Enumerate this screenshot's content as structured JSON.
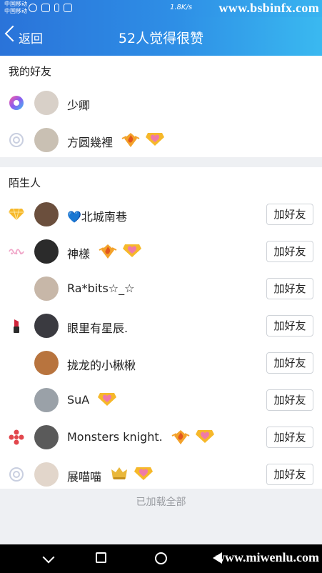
{
  "statusbar": {
    "carrier1": "中国移动",
    "carrier2": "中国移动",
    "speed": "1.8K/s",
    "watermark": "www.bsbinfx.com"
  },
  "navbar": {
    "back_label": "返回",
    "title": "52人觉得很赞"
  },
  "friends": {
    "header": "我的好友",
    "items": [
      {
        "name": "少卿",
        "badge_icon": "colorful-orb-icon",
        "tags": []
      },
      {
        "name": "方圆幾裡",
        "badge_icon": "swirl-icon",
        "tags": [
          "flame-diamond-icon",
          "heart-diamond-icon"
        ]
      }
    ]
  },
  "strangers": {
    "header": "陌生人",
    "add_label": "加好友",
    "items": [
      {
        "name": "💙北城南巷",
        "badge_icon": "diamond-icon",
        "tags": []
      },
      {
        "name": "神樣",
        "badge_icon": "pink-lace-icon",
        "tags": [
          "flame-diamond-icon",
          "heart-diamond-icon"
        ]
      },
      {
        "name": "Ra*bits☆_☆",
        "badge_icon": "",
        "tags": []
      },
      {
        "name": "眼里有星辰.",
        "badge_icon": "lipstick-icon",
        "tags": []
      },
      {
        "name": "拢龙的小楸楸",
        "badge_icon": "",
        "tags": []
      },
      {
        "name": "SuA",
        "badge_icon": "",
        "tags": [
          "heart-diamond-icon"
        ]
      },
      {
        "name": "Monsters knight.",
        "badge_icon": "red-knot-icon",
        "tags": [
          "flame-diamond-icon",
          "heart-diamond-icon"
        ]
      },
      {
        "name": "展喵喵",
        "badge_icon": "swirl-icon",
        "tags": [
          "crown-diamond-icon",
          "heart-diamond-icon"
        ]
      }
    ]
  },
  "footer": {
    "loaded_text": "已加载全部"
  },
  "sysnav": {
    "watermark": "www.miwenlu.com"
  },
  "colors": {
    "accent": "#2e8fe6",
    "diamond": "#f6b82a",
    "heart": "#ef7aa7"
  }
}
